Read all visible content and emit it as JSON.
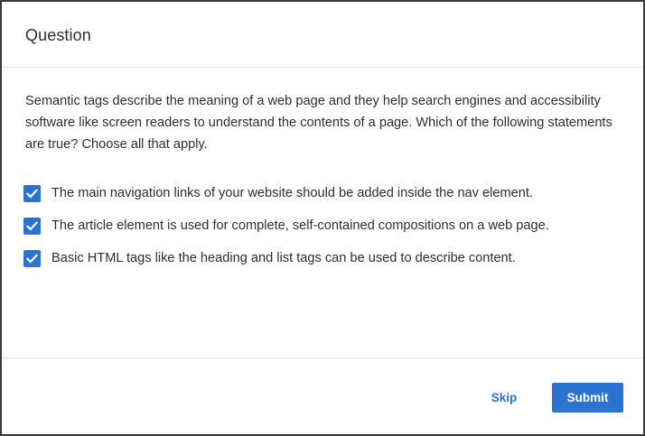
{
  "dialog": {
    "title": "Question",
    "prompt": "Semantic tags describe the meaning of a web page and they help search engines and accessibility software like screen readers  to understand the contents of a page. Which of the following statements are true? Choose all that apply.",
    "options": [
      {
        "label": "The main navigation links of your website should be added inside the nav element.",
        "checked": true
      },
      {
        "label": "The article element is used for complete, self-contained compositions on a web page.",
        "checked": true
      },
      {
        "label": "Basic HTML tags like the heading and list tags can be used to describe content.",
        "checked": true
      }
    ],
    "skip_label": "Skip",
    "submit_label": "Submit"
  },
  "colors": {
    "accent": "#2a73d0",
    "text": "#2d2d2d",
    "divider": "#e3e3e3"
  },
  "icons": {
    "checkbox": "check-icon"
  }
}
